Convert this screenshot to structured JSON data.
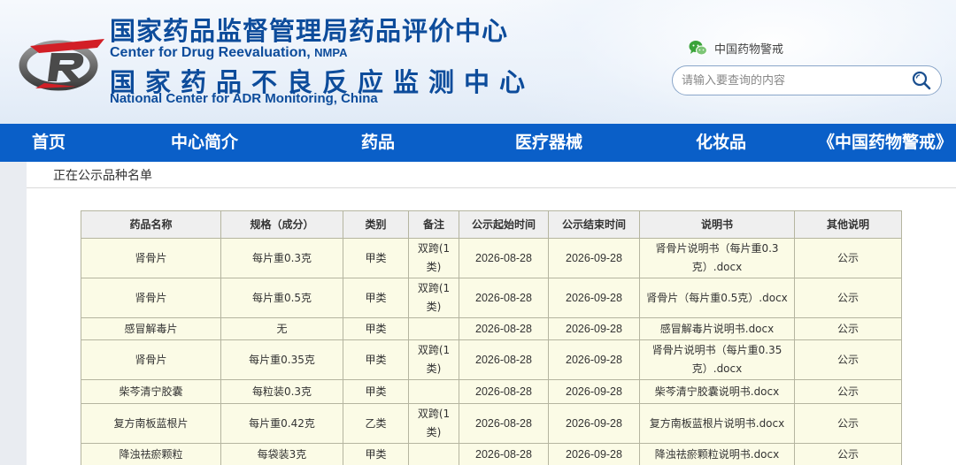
{
  "header": {
    "title_cn": "国家药品监督管理局药品评价中心",
    "title_en_prefix": "Center for Drug Reevaluation, ",
    "title_en_suffix": "NMPA",
    "subtitle_cn": "国家药品不良反应监测中心",
    "subtitle_en": "National Center for ADR Monitoring, China",
    "wechat_label": "中国药物警戒",
    "wechat_icon": "wechat-icon",
    "search_placeholder": "请输入要查询的内容",
    "search_icon": "search-icon"
  },
  "nav": {
    "items": [
      "首页",
      "中心简介",
      "药品",
      "医疗器械",
      "化妆品",
      "《中国药物警戒》"
    ]
  },
  "section": {
    "title": "正在公示品种名单"
  },
  "table": {
    "headers": [
      "药品名称",
      "规格（成分）",
      "类别",
      "备注",
      "公示起始时间",
      "公示结束时间",
      "说明书",
      "其他说明"
    ],
    "rows": [
      [
        "肾骨片",
        "每片重0.3克",
        "甲类",
        "双跨(1类)",
        "2026-08-28",
        "2026-09-28",
        "肾骨片说明书（每片重0.3克）.docx",
        "公示"
      ],
      [
        "肾骨片",
        "每片重0.5克",
        "甲类",
        "双跨(1类)",
        "2026-08-28",
        "2026-09-28",
        "肾骨片（每片重0.5克）.docx",
        "公示"
      ],
      [
        "感冒解毒片",
        "无",
        "甲类",
        "",
        "2026-08-28",
        "2026-09-28",
        "感冒解毒片说明书.docx",
        "公示"
      ],
      [
        "肾骨片",
        "每片重0.35克",
        "甲类",
        "双跨(1类)",
        "2026-08-28",
        "2026-09-28",
        "肾骨片说明书（每片重0.35克）.docx",
        "公示"
      ],
      [
        "柴芩清宁胶囊",
        "每粒装0.3克",
        "甲类",
        "",
        "2026-08-28",
        "2026-09-28",
        "柴芩清宁胶囊说明书.docx",
        "公示"
      ],
      [
        "复方南板蓝根片",
        "每片重0.42克",
        "乙类",
        "双跨(1类)",
        "2026-08-28",
        "2026-09-28",
        "复方南板蓝根片说明书.docx",
        "公示"
      ],
      [
        "降浊祛瘀颗粒",
        "每袋装3克",
        "甲类",
        "",
        "2026-08-28",
        "2026-09-28",
        "降浊祛瘀颗粒说明书.docx",
        "公示"
      ]
    ]
  },
  "colors": {
    "brand_blue": "#0d4c9b",
    "nav_blue": "#0a5fc8",
    "row_bg": "#fbfbe6",
    "header_bg": "#efefef"
  }
}
